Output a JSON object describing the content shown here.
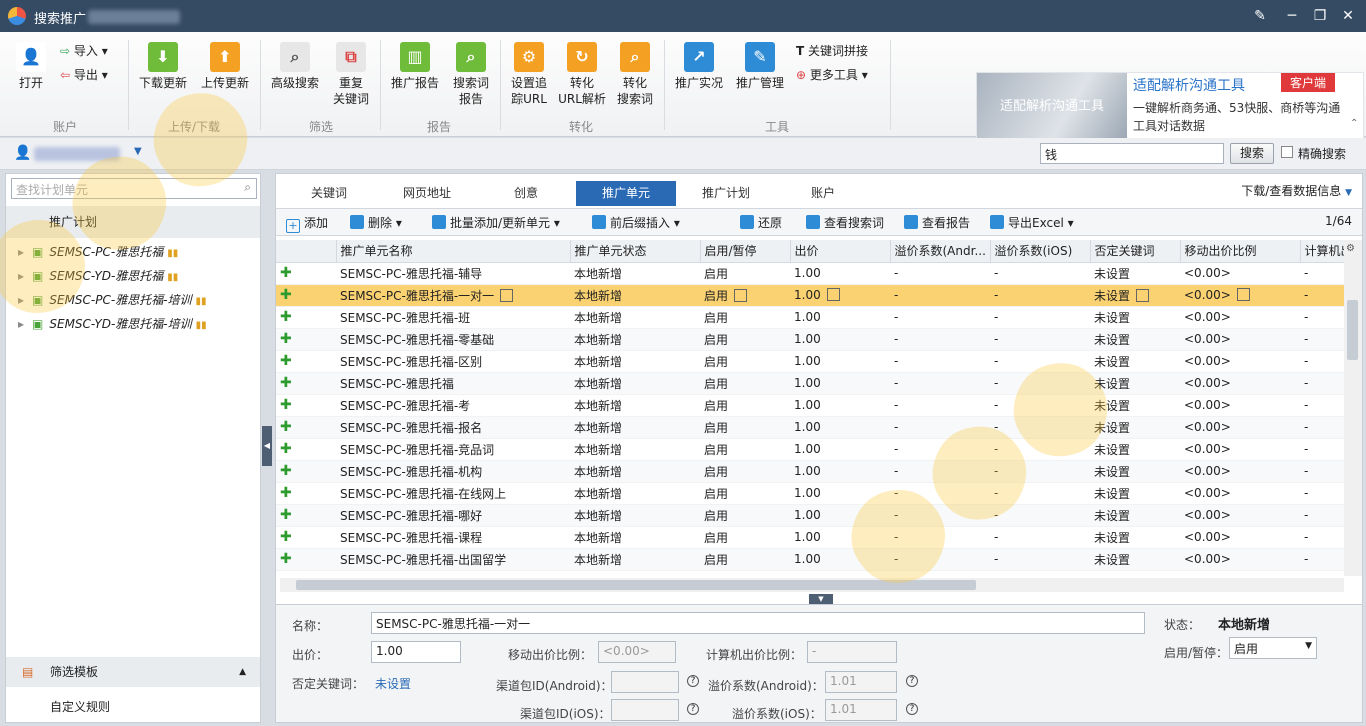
{
  "app": {
    "title": "搜索推广"
  },
  "ribbon": {
    "open": "打开",
    "import": "导入",
    "export": "导出",
    "download_update": "下载更新",
    "upload_update": "上传更新",
    "advanced_search": "高级搜索",
    "dup_kw_1": "重复",
    "dup_kw_2": "关键词",
    "promo_report": "推广报告",
    "search_term_1": "搜索词",
    "search_term_2": "报告",
    "track_1": "设置追",
    "track_2": "踪URL",
    "convert_url_1": "转化",
    "convert_url_2": "URL解析",
    "convert_term_1": "转化",
    "convert_term_2": "搜索词",
    "promo_live": "推广实况",
    "promo_manage": "推广管理",
    "kw_combine": "关键词拼接",
    "more_tools": "更多工具",
    "groups": {
      "account": "账户",
      "updown": "上传/下载",
      "filter": "筛选",
      "report": "报告",
      "convert": "转化",
      "tools": "工具"
    }
  },
  "ad": {
    "image_text": "适配解析沟通工具",
    "heading": "适配解析沟通工具",
    "tag": "客户端",
    "text": "一键解析商务通、53快服、商桥等沟通工具对话数据"
  },
  "search": {
    "value": "钱",
    "button": "搜索",
    "exact": "精确搜索"
  },
  "left": {
    "search_placeholder": "查找计划单元",
    "header": "推广计划",
    "plans": [
      "SEMSC-PC-雅思托福",
      "SEMSC-YD-雅思托福",
      "SEMSC-PC-雅思托福-培训",
      "SEMSC-YD-雅思托福-培训"
    ],
    "filter_template": "筛选模板",
    "custom_rule": "自定义规则"
  },
  "tabs": [
    "关键词",
    "网页地址",
    "创意",
    "推广单元",
    "推广计划",
    "账户"
  ],
  "download_info": "下载/查看数据信息",
  "toolbar": {
    "add": "添加",
    "delete": "删除",
    "batch": "批量添加/更新单元",
    "insert": "前后缀插入",
    "restore": "还原",
    "view_terms": "查看搜索词",
    "view_report": "查看报告",
    "export_excel": "导出Excel",
    "page": "1/64"
  },
  "table": {
    "columns": [
      "推广单元名称",
      "推广单元状态",
      "启用/暂停",
      "出价",
      "溢价系数(Andr...",
      "溢价系数(iOS)",
      "否定关键词",
      "移动出价比例",
      "计算机出"
    ],
    "rows": [
      [
        "SEMSC-PC-雅思托福-辅导",
        "本地新增",
        "启用",
        "1.00",
        "-",
        "-",
        "未设置",
        "<0.00>",
        "-"
      ],
      [
        "SEMSC-PC-雅思托福-一对一",
        "本地新增",
        "启用",
        "1.00",
        "-",
        "-",
        "未设置",
        "<0.00>",
        "-"
      ],
      [
        "SEMSC-PC-雅思托福-班",
        "本地新增",
        "启用",
        "1.00",
        "-",
        "-",
        "未设置",
        "<0.00>",
        "-"
      ],
      [
        "SEMSC-PC-雅思托福-零基础",
        "本地新增",
        "启用",
        "1.00",
        "-",
        "-",
        "未设置",
        "<0.00>",
        "-"
      ],
      [
        "SEMSC-PC-雅思托福-区别",
        "本地新增",
        "启用",
        "1.00",
        "-",
        "-",
        "未设置",
        "<0.00>",
        "-"
      ],
      [
        "SEMSC-PC-雅思托福",
        "本地新增",
        "启用",
        "1.00",
        "-",
        "-",
        "未设置",
        "<0.00>",
        "-"
      ],
      [
        "SEMSC-PC-雅思托福-考",
        "本地新增",
        "启用",
        "1.00",
        "-",
        "-",
        "未设置",
        "<0.00>",
        "-"
      ],
      [
        "SEMSC-PC-雅思托福-报名",
        "本地新增",
        "启用",
        "1.00",
        "-",
        "-",
        "未设置",
        "<0.00>",
        "-"
      ],
      [
        "SEMSC-PC-雅思托福-竞品词",
        "本地新增",
        "启用",
        "1.00",
        "-",
        "-",
        "未设置",
        "<0.00>",
        "-"
      ],
      [
        "SEMSC-PC-雅思托福-机构",
        "本地新增",
        "启用",
        "1.00",
        "-",
        "-",
        "未设置",
        "<0.00>",
        "-"
      ],
      [
        "SEMSC-PC-雅思托福-在线网上",
        "本地新增",
        "启用",
        "1.00",
        "-",
        "-",
        "未设置",
        "<0.00>",
        "-"
      ],
      [
        "SEMSC-PC-雅思托福-哪好",
        "本地新增",
        "启用",
        "1.00",
        "-",
        "-",
        "未设置",
        "<0.00>",
        "-"
      ],
      [
        "SEMSC-PC-雅思托福-课程",
        "本地新增",
        "启用",
        "1.00",
        "-",
        "-",
        "未设置",
        "<0.00>",
        "-"
      ],
      [
        "SEMSC-PC-雅思托福-出国留学",
        "本地新增",
        "启用",
        "1.00",
        "-",
        "-",
        "未设置",
        "<0.00>",
        "-"
      ]
    ]
  },
  "detail": {
    "name_label": "名称：",
    "name": "SEMSC-PC-雅思托福-一对一",
    "status_label": "状态：",
    "status": "本地新增",
    "bid_label": "出价：",
    "bid": "1.00",
    "mobile_ratio_label": "移动出价比例：",
    "mobile_ratio": "<0.00>",
    "pc_ratio_label": "计算机出价比例：",
    "pc_ratio": "-",
    "enable_label": "启用/暂停：",
    "enable": "启用",
    "neg_label": "否定关键词：",
    "neg": "未设置",
    "android_pkg_label": "渠道包ID(Android)：",
    "ios_pkg_label": "渠道包ID(iOS)：",
    "android_coef_label": "溢价系数(Android)：",
    "android_coef": "1.01",
    "ios_coef_label": "溢价系数(iOS)：",
    "ios_coef": "1.01"
  }
}
